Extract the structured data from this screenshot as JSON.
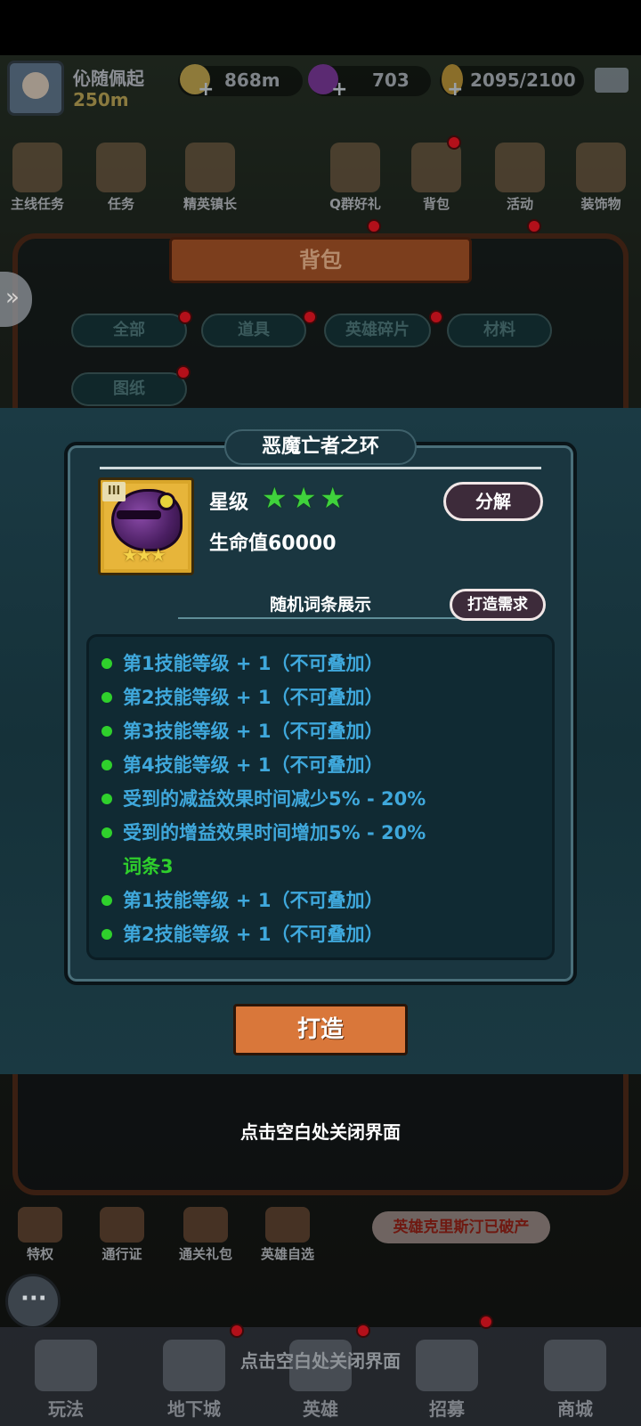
{
  "player": {
    "name": "伈随佩起",
    "level": "250m"
  },
  "resources": [
    {
      "name": "gold",
      "value": "868m",
      "icon": "gold-coin-icon",
      "color": "#c9a43a"
    },
    {
      "name": "gem",
      "value": "703",
      "icon": "purple-gem-icon",
      "color": "#8a2ab5"
    },
    {
      "name": "energy",
      "value": "2095/2100",
      "icon": "lightning-icon",
      "color": "#d9a62a"
    }
  ],
  "top_menu": [
    "主线任务",
    "任务",
    "精英镇长",
    "Q群好礼",
    "背包",
    "活动",
    "装饰物"
  ],
  "bag": {
    "title": "背包",
    "tabs": [
      "全部",
      "道具",
      "英雄碎片",
      "材料",
      "图纸"
    ]
  },
  "item": {
    "name": "恶魔亡者之环",
    "tier": "III",
    "star_label": "星级",
    "stars": 3,
    "stat": "生命值60000",
    "decompose_label": "分解",
    "affix_section_title": "随机词条展示",
    "craft_requirement_label": "打造需求",
    "affix_group_header": "词条3",
    "affixes_group1": [
      "第1技能等级 + 1（不可叠加）",
      "第2技能等级 + 1（不可叠加）",
      "第3技能等级 + 1（不可叠加）",
      "第4技能等级 + 1（不可叠加）",
      "受到的减益效果时间减少5% - 20%",
      "受到的增益效果时间增加5% - 20%"
    ],
    "affixes_group3": [
      "第1技能等级 + 1（不可叠加）",
      "第2技能等级 + 1（不可叠加）"
    ],
    "craft_button": "打造"
  },
  "close_hint": "点击空白处关闭界面",
  "bottom_row": [
    "特权",
    "通行证",
    "通关礼包",
    "英雄自选"
  ],
  "notice": "英雄克里斯汀已破产",
  "navbar": [
    "玩法",
    "地下城",
    "英雄",
    "招募",
    "商城"
  ],
  "colors": {
    "affix_text": "#3fa8dc",
    "affix_bullet": "#2fd02c",
    "star_green": "#3fd23c",
    "craft_button": "#d9773a",
    "modal_bg": "#1a3640"
  }
}
